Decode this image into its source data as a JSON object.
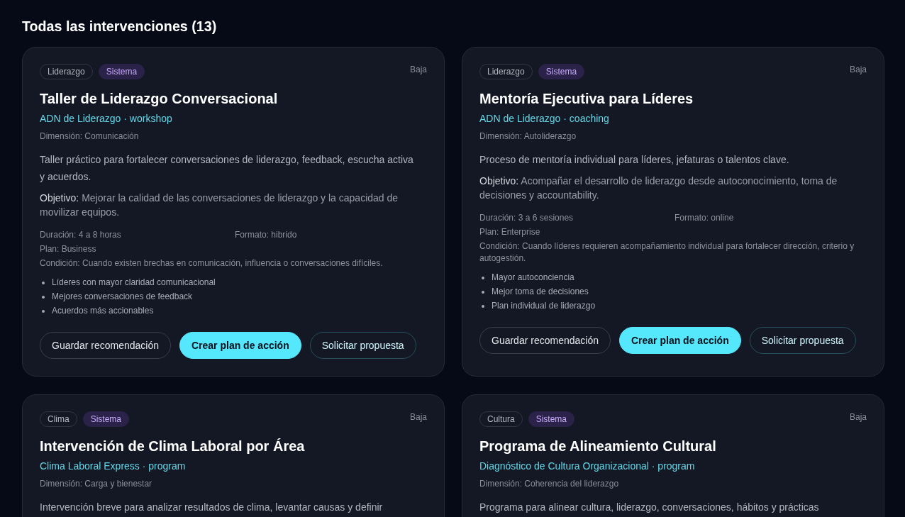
{
  "heading": "Todas las intervenciones (13)",
  "cards": [
    {
      "tags": [
        {
          "label": "Liderazgo",
          "kind": "outline"
        },
        {
          "label": "Sistema",
          "kind": "filled"
        }
      ],
      "priority": "Baja",
      "title": "Taller de Liderazgo Conversacional",
      "subtitle": "ADN de Liderazgo · workshop",
      "dimension": "Dimensión: Comunicación",
      "description": "Taller práctico para fortalecer conversaciones de liderazgo, feedback, escucha activa y acuerdos.",
      "objective": "**Objetivo:** Mejorar la calidad de las conversaciones de liderazgo y la capacidad de movilizar equipos.",
      "meta": {
        "duration": "Duración: 4 a 8 horas",
        "format": "Formato: hibrido",
        "plan": "Plan: Business",
        "condition": "Condición: Cuando existen brechas en comunicación, influencia o conversaciones difíciles."
      },
      "benefits": [
        "Líderes con mayor claridad comunicacional",
        "Mejores conversaciones de feedback",
        "Acuerdos más accionables"
      ],
      "buttons": [
        {
          "label": "Guardar recomendación",
          "kind": "ghost"
        },
        {
          "label": "Crear plan de acción",
          "kind": "primary"
        },
        {
          "label": "Solicitar propuesta",
          "kind": "accent"
        }
      ]
    },
    {
      "tags": [
        {
          "label": "Liderazgo",
          "kind": "outline"
        },
        {
          "label": "Sistema",
          "kind": "filled"
        }
      ],
      "priority": "Baja",
      "title": "Mentoría Ejecutiva para Líderes",
      "subtitle": "ADN de Liderazgo · coaching",
      "dimension": "Dimensión: Autoliderazgo",
      "description": "Proceso de mentoría individual para líderes, jefaturas o talentos clave.",
      "objective": "**Objetivo:** Acompañar el desarrollo de liderazgo desde autoconocimiento, toma de decisiones y accountability.",
      "meta": {
        "duration": "Duración: 3 a 6 sesiones",
        "format": "Formato: online",
        "plan": "Plan: Enterprise",
        "condition": "Condición: Cuando líderes requieren acompañamiento individual para fortalecer dirección, criterio y autogestión."
      },
      "benefits": [
        "Mayor autoconciencia",
        "Mejor toma de decisiones",
        "Plan individual de liderazgo"
      ],
      "buttons": [
        {
          "label": "Guardar recomendación",
          "kind": "ghost"
        },
        {
          "label": "Crear plan de acción",
          "kind": "primary"
        },
        {
          "label": "Solicitar propuesta",
          "kind": "accent"
        }
      ]
    },
    {
      "tags": [
        {
          "label": "Clima",
          "kind": "outline"
        },
        {
          "label": "Sistema",
          "kind": "filled"
        }
      ],
      "priority": "Baja",
      "title": "Intervención de Clima Laboral por Área",
      "subtitle": "Clima Laboral Express · program",
      "dimension": "Dimensión: Carga y bienestar",
      "description": "Intervención breve para analizar resultados de clima, levantar causas y definir"
    },
    {
      "tags": [
        {
          "label": "Cultura",
          "kind": "outline"
        },
        {
          "label": "Sistema",
          "kind": "filled"
        }
      ],
      "priority": "Baja",
      "title": "Programa de Alineamiento Cultural",
      "subtitle": "Diagnóstico de Cultura Organizacional · program",
      "dimension": "Dimensión: Coherencia del liderazgo",
      "description": "Programa para alinear cultura, liderazgo, conversaciones, hábitos y prácticas"
    }
  ]
}
